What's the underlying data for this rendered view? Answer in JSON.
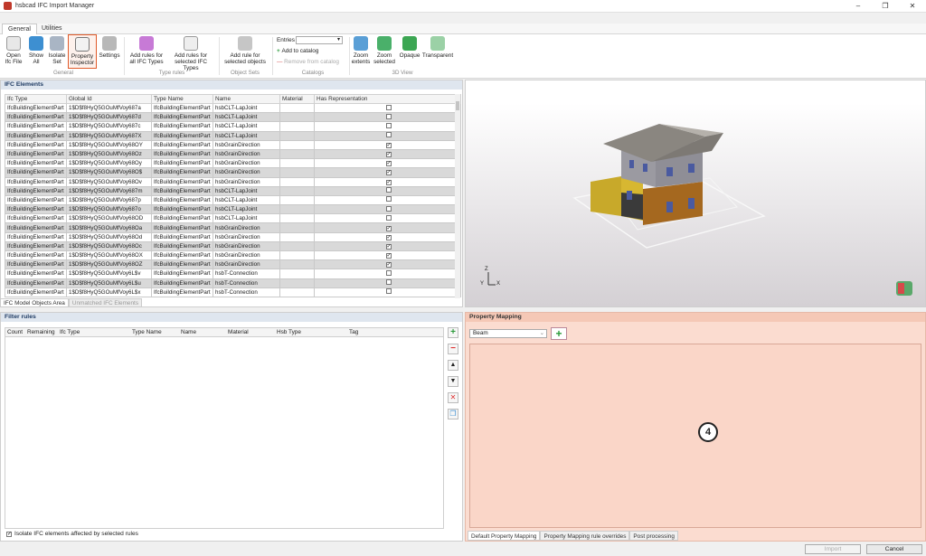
{
  "window": {
    "title": "hsbcad IFC Import Manager",
    "controls": [
      "–",
      "❐",
      "✕"
    ]
  },
  "ribbon": {
    "tabs": [
      "General",
      "Utilities"
    ],
    "buttons": {
      "open": "Open Ifc File",
      "show_all": "Show All",
      "isolate": "Isolate Set",
      "property_inspector": "Property Inspector",
      "settings": "Settings",
      "add_rules_all": "Add rules for all IFC Types",
      "add_rules_selected": "Add rules for selected IFC Types",
      "add_rule_objects": "Add rule for selected objects",
      "zoom_extents": "Zoom extents",
      "zoom_selected": "Zoom selected",
      "opaque": "Opaque",
      "transparent": "Transparent"
    },
    "groups": {
      "general": "General",
      "type_rules": "Type rules",
      "object_sets": "Object Sets",
      "catalogs": "Catalogs",
      "view3d": "3D View"
    },
    "catalog": {
      "entries_label": "Entries",
      "entries_value": "▾",
      "add": "Add to catalog",
      "remove": "Remove from catalog"
    }
  },
  "ifc_elements": {
    "title": "IFC Elements",
    "columns": [
      "Ifc Type",
      "Global Id",
      "Type Name",
      "Name",
      "Material",
      "Has Representation"
    ],
    "rows": [
      [
        "IfcBuildingElementPart",
        "1$D$f8HyQ5GOuMfVoy687a",
        "IfcBuildingElementPart",
        "hsbCLT-LapJoint",
        "",
        false
      ],
      [
        "IfcBuildingElementPart",
        "1$D$f8HyQ5GOuMfVoy687d",
        "IfcBuildingElementPart",
        "hsbCLT-LapJoint",
        "",
        false
      ],
      [
        "IfcBuildingElementPart",
        "1$D$f8HyQ5GOuMfVoy687c",
        "IfcBuildingElementPart",
        "hsbCLT-LapJoint",
        "",
        false
      ],
      [
        "IfcBuildingElementPart",
        "1$D$f8HyQ5GOuMfVoy687X",
        "IfcBuildingElementPart",
        "hsbCLT-LapJoint",
        "",
        false
      ],
      [
        "IfcBuildingElementPart",
        "1$D$f8HyQ5GOuMfVoy68OY",
        "IfcBuildingElementPart",
        "hsbGrainDirection",
        "",
        true
      ],
      [
        "IfcBuildingElementPart",
        "1$D$f8HyQ5GOuMfVoy68Oz",
        "IfcBuildingElementPart",
        "hsbGrainDirection",
        "",
        true
      ],
      [
        "IfcBuildingElementPart",
        "1$D$f8HyQ5GOuMfVoy68Oy",
        "IfcBuildingElementPart",
        "hsbGrainDirection",
        "",
        true
      ],
      [
        "IfcBuildingElementPart",
        "1$D$f8HyQ5GOuMfVoy68O$",
        "IfcBuildingElementPart",
        "hsbGrainDirection",
        "",
        true
      ],
      [
        "IfcBuildingElementPart",
        "1$D$f8HyQ5GOuMfVoy68Ov",
        "IfcBuildingElementPart",
        "hsbGrainDirection",
        "",
        true
      ],
      [
        "IfcBuildingElementPart",
        "1$D$f8HyQ5GOuMfVoy687m",
        "IfcBuildingElementPart",
        "hsbCLT-LapJoint",
        "",
        false
      ],
      [
        "IfcBuildingElementPart",
        "1$D$f8HyQ5GOuMfVoy687p",
        "IfcBuildingElementPart",
        "hsbCLT-LapJoint",
        "",
        false
      ],
      [
        "IfcBuildingElementPart",
        "1$D$f8HyQ5GOuMfVoy687o",
        "IfcBuildingElementPart",
        "hsbCLT-LapJoint",
        "",
        false
      ],
      [
        "IfcBuildingElementPart",
        "1$D$f8HyQ5GOuMfVoy68OD",
        "IfcBuildingElementPart",
        "hsbCLT-LapJoint",
        "",
        false
      ],
      [
        "IfcBuildingElementPart",
        "1$D$f8HyQ5GOuMfVoy68Oa",
        "IfcBuildingElementPart",
        "hsbGrainDirection",
        "",
        true
      ],
      [
        "IfcBuildingElementPart",
        "1$D$f8HyQ5GOuMfVoy68Od",
        "IfcBuildingElementPart",
        "hsbGrainDirection",
        "",
        true
      ],
      [
        "IfcBuildingElementPart",
        "1$D$f8HyQ5GOuMfVoy68Oc",
        "IfcBuildingElementPart",
        "hsbGrainDirection",
        "",
        true
      ],
      [
        "IfcBuildingElementPart",
        "1$D$f8HyQ5GOuMfVoy68OX",
        "IfcBuildingElementPart",
        "hsbGrainDirection",
        "",
        true
      ],
      [
        "IfcBuildingElementPart",
        "1$D$f8HyQ5GOuMfVoy68OZ",
        "IfcBuildingElementPart",
        "hsbGrainDirection",
        "",
        true
      ],
      [
        "IfcBuildingElementPart",
        "1$D$f8HyQ5GOuMfVoy6L$v",
        "IfcBuildingElementPart",
        "hsbT-Connection",
        "",
        false
      ],
      [
        "IfcBuildingElementPart",
        "1$D$f8HyQ5GOuMfVoy6L$u",
        "IfcBuildingElementPart",
        "hsbT-Connection",
        "",
        false
      ],
      [
        "IfcBuildingElementPart",
        "1$D$f8HyQ5GOuMfVoy6L$x",
        "IfcBuildingElementPart",
        "hsbT-Connection",
        "",
        false
      ]
    ],
    "bottom_tabs": [
      "IFC Model Objects Area",
      "Unmatched IFC Elements"
    ]
  },
  "view3d": {
    "axis_z": "Z",
    "axis_x": "X",
    "axis_y": "Y"
  },
  "filter_rules": {
    "title": "Filter rules",
    "columns": [
      "Count",
      "Remaining",
      "Ifc Type",
      "Type Name",
      "Name",
      "Material",
      "Hsb Type",
      "Tag"
    ],
    "isolate_label": "Isolate IFC elements affected by selected rules",
    "isolate_checked": true
  },
  "property_mapping": {
    "title": "Property Mapping",
    "selected_type": "Beam",
    "badge": "4",
    "tabs": [
      "Default Property Mapping",
      "Property Mapping rule overrides",
      "Post processing"
    ]
  },
  "footer": {
    "import": "Import",
    "cancel": "Cancel"
  },
  "colors": {
    "accent": "#e05a2a",
    "pm_bg": "#fbdcd0",
    "header_bg": "#dfe6ef"
  }
}
